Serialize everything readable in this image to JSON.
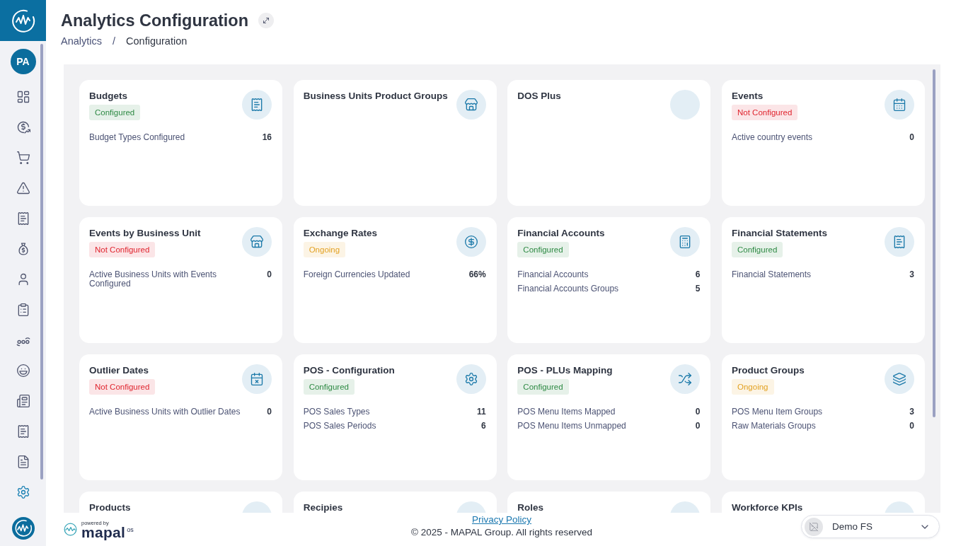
{
  "sidebar": {
    "avatar": "PA",
    "items": [
      {
        "selected": false
      },
      {
        "selected": false
      },
      {
        "selected": false
      },
      {
        "selected": false
      },
      {
        "selected": false
      },
      {
        "selected": false
      },
      {
        "selected": false
      },
      {
        "selected": false
      },
      {
        "selected": false
      },
      {
        "selected": false
      },
      {
        "selected": false
      },
      {
        "selected": false
      },
      {
        "selected": false
      },
      {
        "selected": true
      }
    ]
  },
  "header": {
    "title": "Analytics Configuration",
    "breadcrumb": [
      "Analytics",
      "Configuration"
    ],
    "separator": "/"
  },
  "cards": [
    {
      "title": "Budgets",
      "badge": {
        "label": "Configured",
        "color": "#2e8a44"
      },
      "stats": [
        {
          "label": "Budget Types Configured",
          "value": "16"
        }
      ]
    },
    {
      "title": "Business Units Product Groups"
    },
    {
      "title": "DOS Plus"
    },
    {
      "title": "Events",
      "badge": {
        "label": "Not Configured",
        "color": "#e0252f"
      },
      "stats": [
        {
          "label": "Active country events",
          "value": "0"
        }
      ]
    },
    {
      "title": "Events by Business Unit",
      "badge": {
        "label": "Not Configured",
        "color": "#e0252f"
      },
      "stats": [
        {
          "label": "Active Business Units with Events Configured",
          "value": "0"
        }
      ]
    },
    {
      "title": "Exchange Rates",
      "badge": {
        "label": "Ongoing",
        "color": "#e3a224"
      },
      "stats": [
        {
          "label": "Foreign Currencies Updated",
          "value": "66%"
        }
      ]
    },
    {
      "title": "Financial Accounts",
      "badge": {
        "label": "Configured",
        "color": "#2e8a44"
      },
      "stats": [
        {
          "label": "Financial Accounts",
          "value": "6"
        },
        {
          "label": "Financial Accounts Groups",
          "value": "5"
        }
      ]
    },
    {
      "title": "Financial Statements",
      "badge": {
        "label": "Configured",
        "color": "#2e8a44"
      },
      "stats": [
        {
          "label": "Financial Statements",
          "value": "3"
        }
      ]
    },
    {
      "title": "Outlier Dates",
      "badge": {
        "label": "Not Configured",
        "color": "#e0252f"
      },
      "stats": [
        {
          "label": "Active Business Units with Outlier Dates",
          "value": "0"
        }
      ]
    },
    {
      "title": "POS - Configuration",
      "badge": {
        "label": "Configured",
        "color": "#2e8a44"
      },
      "stats": [
        {
          "label": "POS Sales Types",
          "value": "11"
        },
        {
          "label": "POS Sales Periods",
          "value": "6"
        }
      ]
    },
    {
      "title": "POS - PLUs Mapping",
      "badge": {
        "label": "Configured",
        "color": "#2e8a44"
      },
      "stats": [
        {
          "label": "POS Menu Items Mapped",
          "value": "0"
        },
        {
          "label": "POS Menu Items Unmapped",
          "value": "0"
        }
      ]
    },
    {
      "title": "Product Groups",
      "badge": {
        "label": "Ongoing",
        "color": "#e3a224"
      },
      "stats": [
        {
          "label": "POS Menu Item Groups",
          "value": "3"
        },
        {
          "label": "Raw Materials Groups",
          "value": "0"
        }
      ]
    },
    {
      "title": "Products"
    },
    {
      "title": "Recipies"
    },
    {
      "title": "Roles"
    },
    {
      "title": "Workforce KPIs"
    }
  ],
  "footer": {
    "powered_by": "powered by",
    "brand": "mapal",
    "brand_suffix": "os",
    "privacy_link": "Privacy Policy",
    "copyright": "© 2025 - MAPAL Group. All rights reserved",
    "account": {
      "name": "Demo FS"
    }
  }
}
